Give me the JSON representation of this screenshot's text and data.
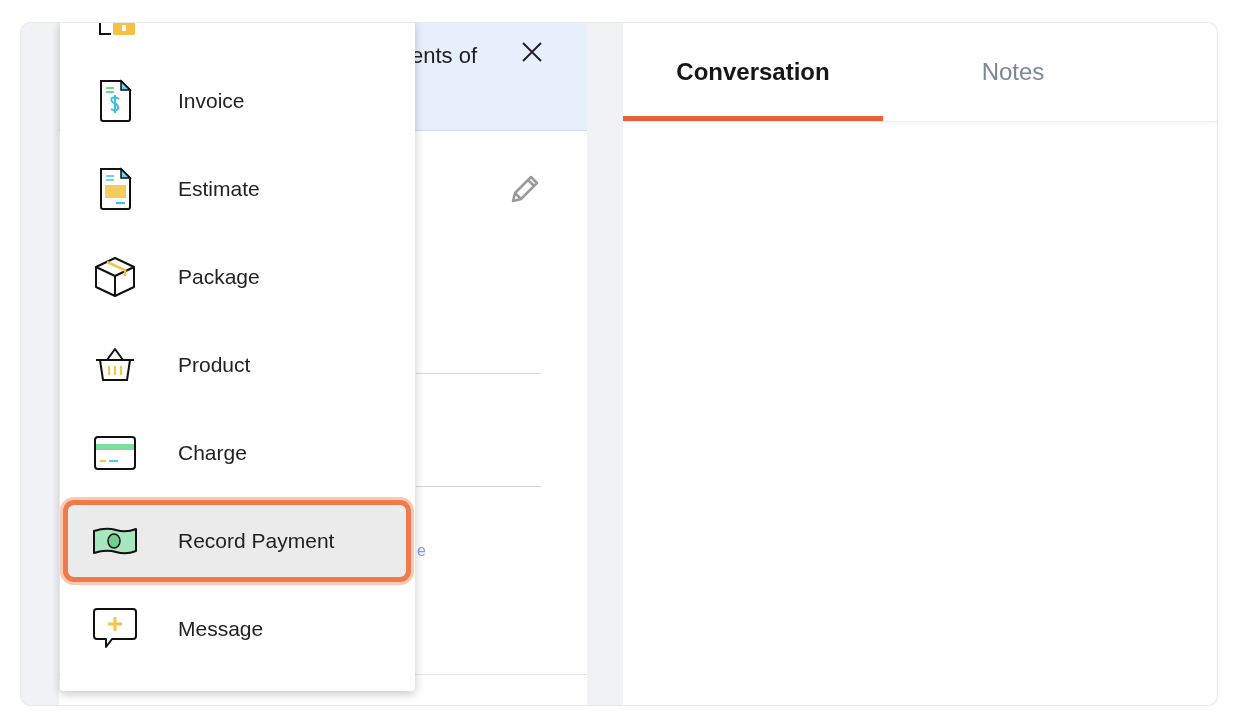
{
  "detail_panel": {
    "header_text": "ents of",
    "link_text": "e"
  },
  "tabs": [
    {
      "label": "Conversation",
      "selected": true
    },
    {
      "label": "Notes",
      "selected": false
    }
  ],
  "create_menu": {
    "items": [
      {
        "label": "Invoice",
        "selected": false
      },
      {
        "label": "Estimate",
        "selected": false
      },
      {
        "label": "Package",
        "selected": false
      },
      {
        "label": "Product",
        "selected": false
      },
      {
        "label": "Charge",
        "selected": false
      },
      {
        "label": "Record Payment",
        "selected": true
      },
      {
        "label": "Message",
        "selected": false
      }
    ]
  }
}
